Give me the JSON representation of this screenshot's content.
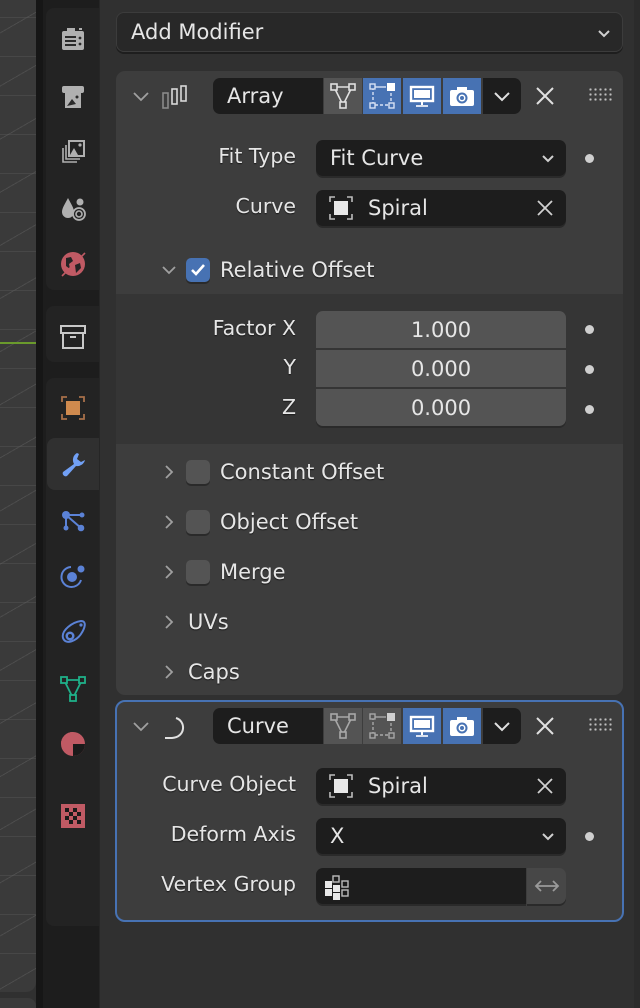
{
  "sidebar": {
    "tabs": [
      {
        "id": "tool",
        "icon": "tool-icon",
        "active": false
      },
      {
        "id": "render",
        "icon": "render-icon",
        "active": false
      },
      {
        "id": "output",
        "icon": "output-icon",
        "active": false
      },
      {
        "id": "view-layer",
        "icon": "view-layer-icon",
        "active": false
      },
      {
        "id": "scene",
        "icon": "scene-icon",
        "active": false
      },
      {
        "id": "world",
        "icon": "world-icon",
        "active": false
      },
      {
        "id": "collection",
        "icon": "collection-icon",
        "active": false
      },
      {
        "id": "object",
        "icon": "object-icon",
        "active": false
      },
      {
        "id": "modifiers",
        "icon": "wrench-icon",
        "active": true
      },
      {
        "id": "particles",
        "icon": "particles-icon",
        "active": false
      },
      {
        "id": "physics",
        "icon": "physics-icon",
        "active": false
      },
      {
        "id": "constraints",
        "icon": "constraints-icon",
        "active": false
      },
      {
        "id": "data",
        "icon": "mesh-data-icon",
        "active": false
      },
      {
        "id": "material",
        "icon": "material-icon",
        "active": false
      },
      {
        "id": "texture",
        "icon": "texture-icon",
        "active": false
      }
    ]
  },
  "colors": {
    "accent": "#4772b3",
    "wrench": "#71a0f5",
    "world": "#c05a64",
    "object": "#d08a4e",
    "mesh": "#1fb089",
    "material": "#c05a64"
  },
  "add_modifier": {
    "label": "Add Modifier"
  },
  "modifiers": [
    {
      "name": "Array",
      "type_icon": "array-modifier-icon",
      "toggles": {
        "edit_cage": false,
        "edit_mode": true,
        "viewport": true,
        "render": true
      },
      "fields": {
        "fit_type": {
          "label": "Fit Type",
          "value": "Fit Curve"
        },
        "curve": {
          "label": "Curve",
          "value": "Spiral"
        }
      },
      "relative_offset": {
        "label": "Relative Offset",
        "checked": true,
        "expanded": true,
        "factor_label": "Factor X",
        "y_label": "Y",
        "z_label": "Z",
        "x": "1.000",
        "y": "0.000",
        "z": "0.000"
      },
      "subpanels": [
        {
          "label": "Constant Offset",
          "checkbox": true,
          "checked": false
        },
        {
          "label": "Object Offset",
          "checkbox": true,
          "checked": false
        },
        {
          "label": "Merge",
          "checkbox": true,
          "checked": false
        },
        {
          "label": "UVs",
          "checkbox": false
        },
        {
          "label": "Caps",
          "checkbox": false
        }
      ]
    },
    {
      "name": "Curve",
      "type_icon": "curve-modifier-icon",
      "active": true,
      "toggles": {
        "edit_cage": false,
        "edit_mode": false,
        "viewport": true,
        "render": true
      },
      "fields": {
        "curve_object": {
          "label": "Curve Object",
          "value": "Spiral"
        },
        "deform_axis": {
          "label": "Deform Axis",
          "value": "X"
        },
        "vertex_group": {
          "label": "Vertex Group",
          "value": ""
        }
      }
    }
  ]
}
